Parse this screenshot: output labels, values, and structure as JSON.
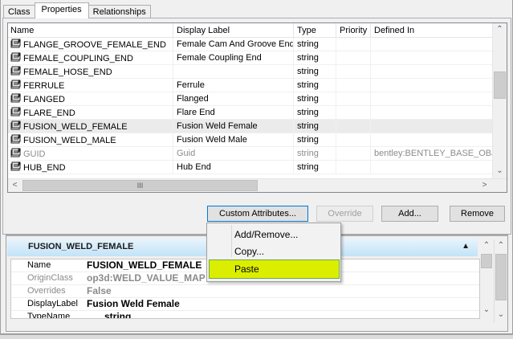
{
  "tabs": [
    {
      "label": "Class"
    },
    {
      "label": "Properties"
    },
    {
      "label": "Relationships"
    }
  ],
  "grid": {
    "columns": [
      "Name",
      "Display Label",
      "Type",
      "Priority",
      "Defined In"
    ],
    "rows": [
      {
        "name": "FLANGE_GROOVE_FEMALE_END",
        "label": "Female Cam And Groove End",
        "type": "string",
        "priority": "",
        "defined_in": ""
      },
      {
        "name": "FEMALE_COUPLING_END",
        "label": "Female Coupling End",
        "type": "string",
        "priority": "",
        "defined_in": ""
      },
      {
        "name": "FEMALE_HOSE_END",
        "label": "",
        "type": "string",
        "priority": "",
        "defined_in": ""
      },
      {
        "name": "FERRULE",
        "label": "Ferrule",
        "type": "string",
        "priority": "",
        "defined_in": ""
      },
      {
        "name": "FLANGED",
        "label": "Flanged",
        "type": "string",
        "priority": "",
        "defined_in": ""
      },
      {
        "name": "FLARE_END",
        "label": "Flare End",
        "type": "string",
        "priority": "",
        "defined_in": ""
      },
      {
        "name": "FUSION_WELD_FEMALE",
        "label": "Fusion Weld Female",
        "type": "string",
        "priority": "",
        "defined_in": ""
      },
      {
        "name": "FUSION_WELD_MALE",
        "label": "Fusion Weld Male",
        "type": "string",
        "priority": "",
        "defined_in": ""
      },
      {
        "name": "GUID",
        "label": "Guid",
        "type": "string",
        "priority": "",
        "defined_in": "bentley:BENTLEY_BASE_OBJE"
      },
      {
        "name": "HUB_END",
        "label": "Hub End",
        "type": "string",
        "priority": "",
        "defined_in": ""
      }
    ]
  },
  "buttons": {
    "custom_attributes": "Custom Attributes...",
    "override": "Override",
    "add": "Add...",
    "remove": "Remove"
  },
  "context_menu": {
    "items": [
      "Add/Remove...",
      "Copy...",
      "Paste"
    ],
    "highlighted": "Paste"
  },
  "details": {
    "title": "FUSION_WELD_FEMALE",
    "properties": [
      {
        "key": "Name",
        "value": "FUSION_WELD_FEMALE"
      },
      {
        "key": "OriginClass",
        "value": "op3d:WELD_VALUE_MAP"
      },
      {
        "key": "Overrides",
        "value": "False"
      },
      {
        "key": "DisplayLabel",
        "value": "Fusion Weld Female"
      },
      {
        "key": "TypeName",
        "value": "string"
      }
    ]
  }
}
